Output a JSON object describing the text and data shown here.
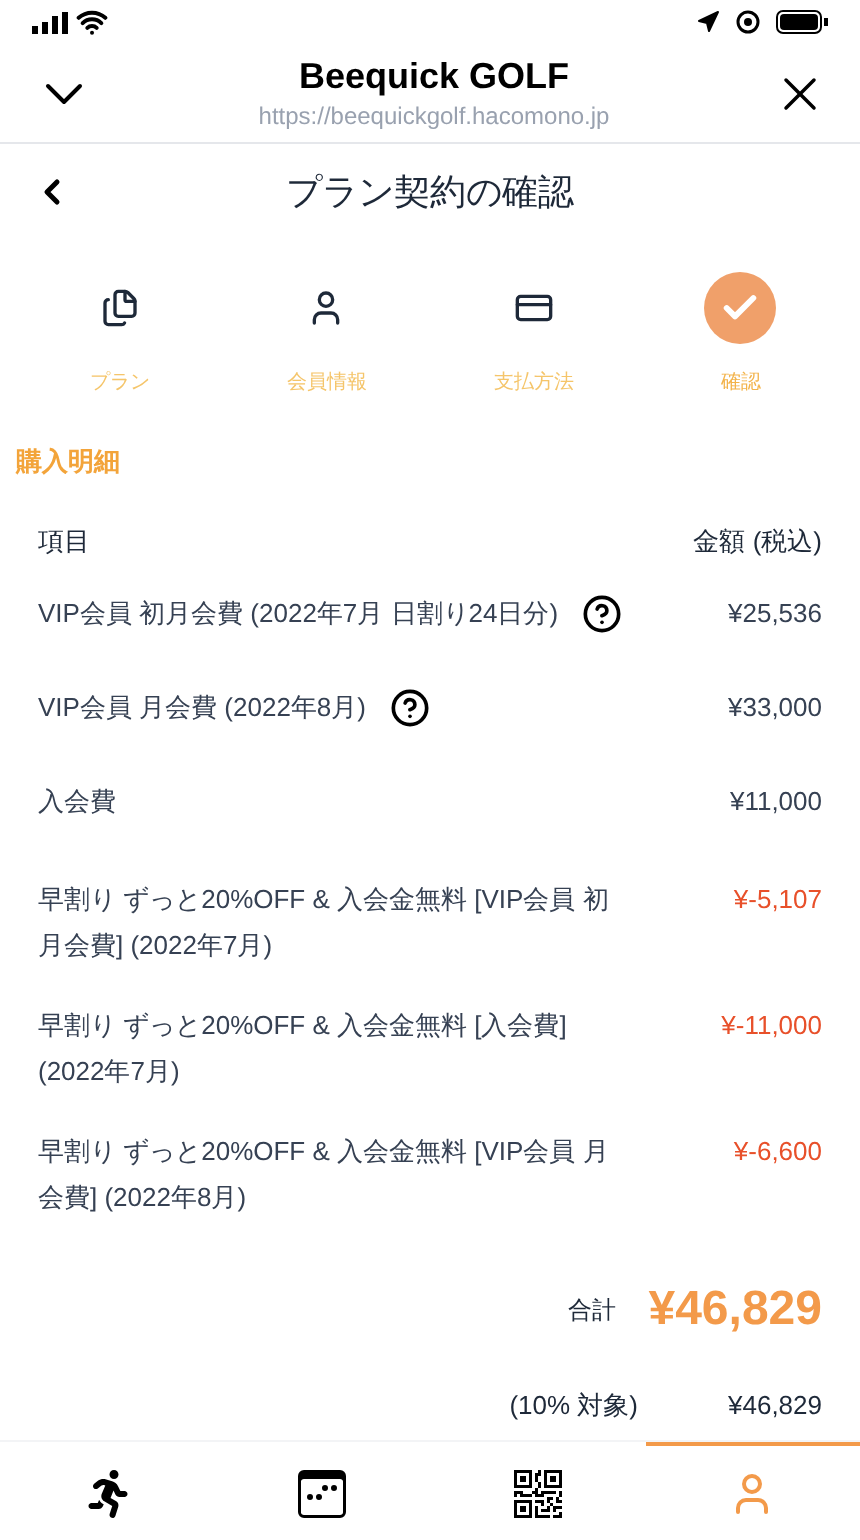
{
  "browser": {
    "title": "Beequick GOLF",
    "url": "https://beequickgolf.hacomono.jp"
  },
  "page": {
    "title": "プラン契約の確認"
  },
  "steps": [
    {
      "label": "プラン",
      "selected": false
    },
    {
      "label": "会員情報",
      "selected": false
    },
    {
      "label": "支払方法",
      "selected": false
    },
    {
      "label": "確認",
      "selected": true
    }
  ],
  "section_title": "購入明細",
  "table": {
    "columns": [
      "項目",
      "金額 (税込)"
    ],
    "rows": [
      {
        "kind": "fee",
        "item": "VIP会員 初月会費 (2022年7月 日割り24日分)",
        "help": true,
        "amount": "¥25,536"
      },
      {
        "kind": "fee",
        "item": "VIP会員 月会費 (2022年8月)",
        "help": true,
        "amount": "¥33,000"
      },
      {
        "kind": "fee",
        "item": "入会費",
        "help": false,
        "amount": "¥11,000"
      },
      {
        "kind": "discount",
        "item": "早割り ずっと20%OFF & 入会金無料 [VIP会員 初月会費] (2022年7月)",
        "help": false,
        "amount": "¥-5,107"
      },
      {
        "kind": "discount",
        "item": "早割り ずっと20%OFF & 入会金無料 [入会費] (2022年7月)",
        "help": false,
        "amount": "¥-11,000"
      },
      {
        "kind": "discount",
        "item": "早割り ずっと20%OFF & 入会金無料 [VIP会員 月会費] (2022年8月)",
        "help": false,
        "amount": "¥-6,600"
      }
    ]
  },
  "total": {
    "label": "合計",
    "amount": "¥46,829"
  },
  "tax": {
    "label": "(10% 対象)",
    "amount": "¥46,829"
  },
  "bottom_nav": [
    {
      "selected": false
    },
    {
      "selected": false
    },
    {
      "selected": false
    },
    {
      "selected": true
    }
  ]
}
